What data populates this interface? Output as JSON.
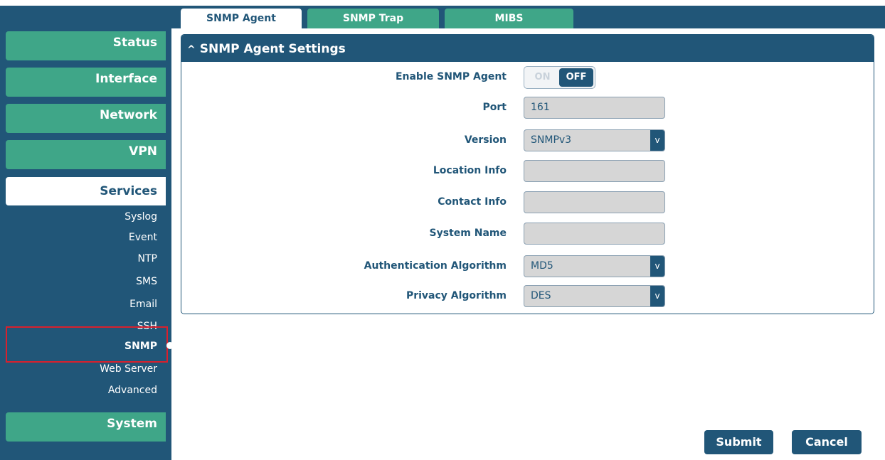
{
  "sidebar": {
    "status": "Status",
    "interface": "Interface",
    "network": "Network",
    "vpn": "VPN",
    "services": "Services",
    "system": "System",
    "sub_items": [
      "Syslog",
      "Event",
      "NTP",
      "SMS",
      "Email",
      "SSH",
      "SNMP",
      "Web Server",
      "Advanced"
    ],
    "active_sub_item": "SNMP"
  },
  "tabs": {
    "snmp_agent": "SNMP Agent",
    "snmp_trap": "SNMP Trap",
    "mibs": "MIBS"
  },
  "panel": {
    "title": "SNMP Agent Settings",
    "enable_label": "Enable SNMP Agent",
    "toggle_on": "ON",
    "toggle_off": "OFF",
    "port_label": "Port",
    "port_value": "161",
    "version_label": "Version",
    "version_value": "SNMPv3",
    "location_label": "Location Info",
    "location_value": "",
    "contact_label": "Contact Info",
    "contact_value": "",
    "system_name_label": "System Name",
    "system_name_value": "",
    "auth_label": "Authentication Algorithm",
    "auth_value": "MD5",
    "privacy_label": "Privacy Algorithm",
    "privacy_value": "DES",
    "select_arrow": "v"
  },
  "buttons": {
    "submit": "Submit",
    "cancel": "Cancel"
  },
  "colors": {
    "navy": "#215678",
    "green": "#3fa688",
    "highlight": "#d9202d"
  }
}
